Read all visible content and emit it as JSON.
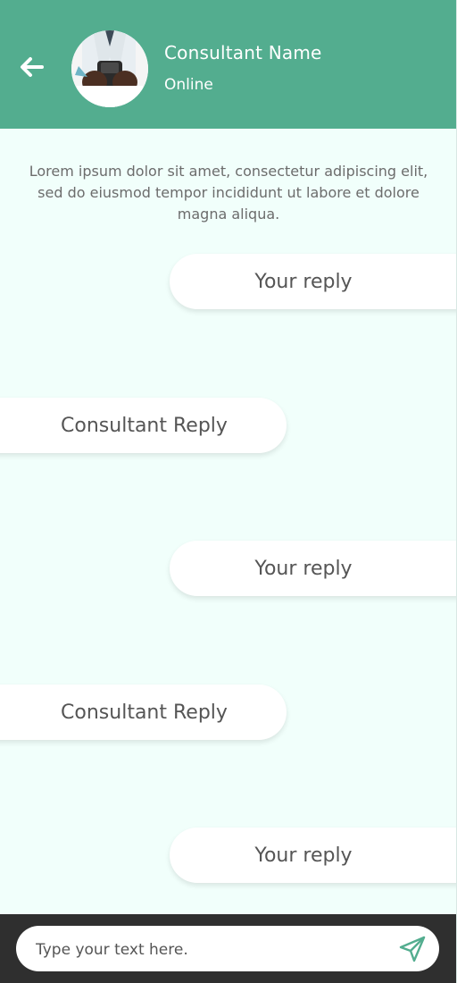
{
  "header": {
    "consultant_name": "Consultant Name",
    "status": "Online",
    "background_color": "#53ad8f",
    "back_icon": "arrow-left-icon",
    "avatar_icon": "consultant-avatar"
  },
  "intro_text": "Lorem ipsum dolor sit amet, consectetur adipiscing elit, sed do eiusmod tempor incididunt ut labore et dolore magna aliqua.",
  "messages": [
    {
      "from": "you",
      "text": "Your reply"
    },
    {
      "from": "consultant",
      "text": "Consultant Reply"
    },
    {
      "from": "you",
      "text": "Your  reply"
    },
    {
      "from": "consultant",
      "text": "Consultant Reply"
    },
    {
      "from": "you",
      "text": "Your reply"
    }
  ],
  "composer": {
    "placeholder": "Type your text here.",
    "send_icon": "send-icon",
    "accent_color": "#53ad8f"
  },
  "colors": {
    "chat_background": "#f1fffb",
    "bottom_bar": "#2f2f2f",
    "bubble_background": "#ffffff"
  }
}
